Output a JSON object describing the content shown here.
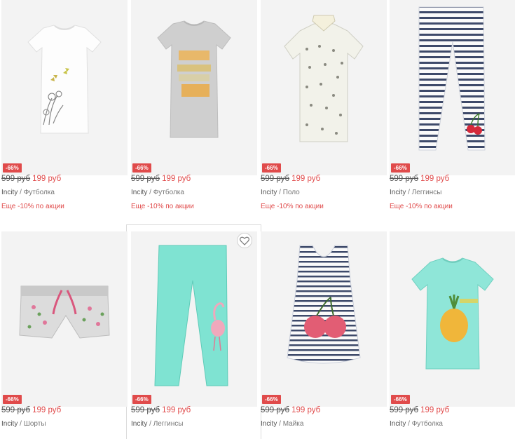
{
  "products": [
    {
      "badge": "-66%",
      "old_price": "599 руб",
      "new_price": "199 руб",
      "brand": "Incity",
      "separator": " / ",
      "category": "Футболка",
      "promo": "Еще -10% по акции"
    },
    {
      "badge": "-66%",
      "old_price": "599 руб",
      "new_price": "199 руб",
      "brand": "Incity",
      "separator": " / ",
      "category": "Футболка",
      "promo": "Еще -10% по акции"
    },
    {
      "badge": "-66%",
      "old_price": "599 руб",
      "new_price": "199 руб",
      "brand": "Incity",
      "separator": " / ",
      "category": "Поло",
      "promo": "Еще -10% по акции"
    },
    {
      "badge": "-66%",
      "old_price": "599 руб",
      "new_price": "199 руб",
      "brand": "Incity",
      "separator": " / ",
      "category": "Леггинсы",
      "promo": "Еще -10% по акции"
    },
    {
      "badge": "-66%",
      "old_price": "599 руб",
      "new_price": "199 руб",
      "brand": "Incity",
      "separator": " / ",
      "category": "Шорты"
    },
    {
      "badge": "-66%",
      "old_price": "599 руб",
      "new_price": "199 руб",
      "brand": "Incity",
      "separator": " / ",
      "category": "Леггинсы"
    },
    {
      "badge": "-66%",
      "old_price": "599 руб",
      "new_price": "199 руб",
      "brand": "Incity",
      "separator": " / ",
      "category": "Майка"
    },
    {
      "badge": "-66%",
      "old_price": "599 руб",
      "new_price": "199 руб",
      "brand": "Incity",
      "separator": " / ",
      "category": "Футболка"
    }
  ],
  "icons": {
    "favorite": "heart-icon"
  },
  "colors": {
    "sale": "#e04b4b",
    "image_bg": "#f3f3f3",
    "mint": "#7fe3d2"
  }
}
